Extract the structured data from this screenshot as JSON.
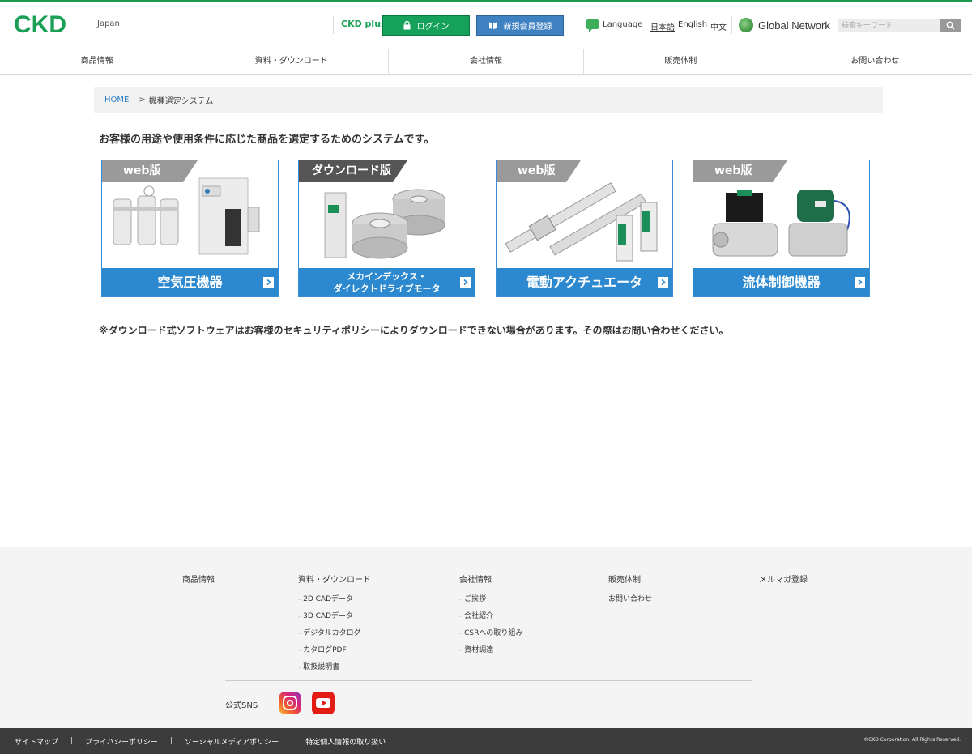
{
  "header": {
    "logo": "CKD",
    "region": "Japan",
    "ckd_plus": "CKD plus",
    "login_label": "ログイン",
    "register_label": "新規会員登録",
    "language_label": "Language",
    "languages": [
      "日本語",
      "English",
      "中文"
    ],
    "global_network": "Global Network",
    "search_placeholder": "検索キーワード"
  },
  "nav": [
    "商品情報",
    "資料・ダウンロード",
    "会社情報",
    "販売体制",
    "お問い合わせ"
  ],
  "breadcrumb": {
    "home": "HOME",
    "separator": ">",
    "current": "機種選定システム"
  },
  "lead": "お客様の用途や使用条件に応じた商品を選定するためのシステムです。",
  "cards": [
    {
      "tag": "web版",
      "title": "空気圧機器"
    },
    {
      "tag": "ダウンロード版",
      "title_line1": "メカインデックス・",
      "title_line2": "ダイレクトドライブモータ"
    },
    {
      "tag": "web版",
      "title": "電動アクチュエータ"
    },
    {
      "tag": "web版",
      "title": "流体制御機器"
    }
  ],
  "note": "※ダウンロード式ソフトウェアはお客様のセキュリティポリシーによりダウンロードできない場合があります。その際はお問い合わせください。",
  "footer": {
    "col1": {
      "head": "商品情報"
    },
    "col2": {
      "head": "資料・ダウンロード",
      "links": [
        "- 2D CADデータ",
        "- 3D CADデータ",
        "- デジタルカタログ",
        "- カタログPDF",
        "- 取扱説明書"
      ]
    },
    "col3": {
      "head": "会社情報",
      "links": [
        "- ご挨拶",
        "- 会社紹介",
        "- CSRへの取り組み",
        "- 資材調達"
      ]
    },
    "col4": {
      "head": "販売体制",
      "links": [
        "お問い合わせ"
      ]
    },
    "col5": {
      "head": "メルマガ登録"
    },
    "sns_label": "公式SNS"
  },
  "bottom_bar": {
    "links": [
      "サイトマップ",
      "プライバシーポリシー",
      "ソーシャルメディアポリシー",
      "特定個人情報の取り扱い"
    ],
    "copyright": "©CKD Corporation. All Rights Reserved."
  },
  "colors": {
    "brand_green": "#19a055",
    "login_green": "#15a15a",
    "register_blue": "#3f82c2",
    "card_blue": "#2c89cf",
    "link_blue": "#2a7dc0"
  }
}
